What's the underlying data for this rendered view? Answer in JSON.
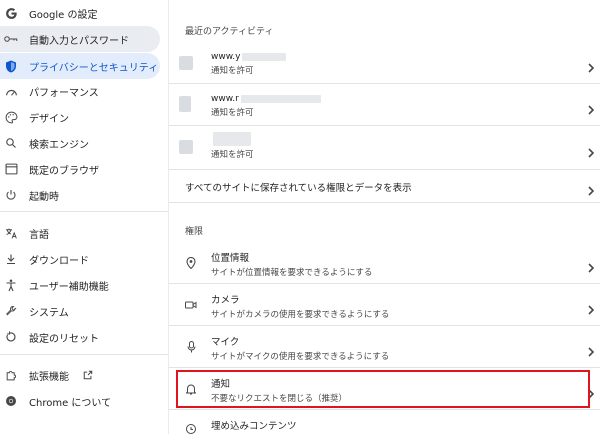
{
  "sidebar": {
    "items": [
      {
        "label": "Google の設定",
        "icon": "google-g-icon"
      },
      {
        "label": "自動入力とパスワード",
        "icon": "key-icon"
      },
      {
        "label": "プライバシーとセキュリティ",
        "icon": "shield-icon"
      },
      {
        "label": "パフォーマンス",
        "icon": "gauge-icon"
      },
      {
        "label": "デザイン",
        "icon": "palette-icon"
      },
      {
        "label": "検索エンジン",
        "icon": "search-icon"
      },
      {
        "label": "既定のブラウザ",
        "icon": "browser-window-icon"
      },
      {
        "label": "起動時",
        "icon": "power-icon"
      },
      {
        "label": "言語",
        "icon": "translate-icon"
      },
      {
        "label": "ダウンロード",
        "icon": "download-icon"
      },
      {
        "label": "ユーザー補助機能",
        "icon": "accessibility-icon"
      },
      {
        "label": "システム",
        "icon": "wrench-icon"
      },
      {
        "label": "設定のリセット",
        "icon": "reset-icon"
      },
      {
        "label": "拡張機能",
        "icon": "puzzle-icon"
      },
      {
        "label": "Chrome について",
        "icon": "chrome-icon"
      }
    ]
  },
  "main": {
    "recent_activity_title": "最近のアクティビティ",
    "recent_sites": [
      {
        "url": "www.y",
        "status": "通知を許可"
      },
      {
        "url": "www.r",
        "status": "通知を許可"
      },
      {
        "url": "",
        "status": "通知を許可"
      }
    ],
    "all_sites_label": "すべてのサイトに保存されている権限とデータを表示",
    "permissions_title": "権限",
    "permissions": [
      {
        "title": "位置情報",
        "sub": "サイトが位置情報を要求できるようにする",
        "icon": "location-pin-icon"
      },
      {
        "title": "カメラ",
        "sub": "サイトがカメラの使用を要求できるようにする",
        "icon": "camera-icon"
      },
      {
        "title": "マイク",
        "sub": "サイトがマイクの使用を要求できるようにする",
        "icon": "microphone-icon"
      },
      {
        "title": "通知",
        "sub": "不要なリクエストを閉じる（推奨）",
        "icon": "bell-icon"
      },
      {
        "title": "埋め込みコンテンツ",
        "sub": "",
        "icon": "embedded-content-icon"
      }
    ]
  },
  "colors": {
    "accent": "#0b57d0",
    "highlight": "#e0141e"
  }
}
